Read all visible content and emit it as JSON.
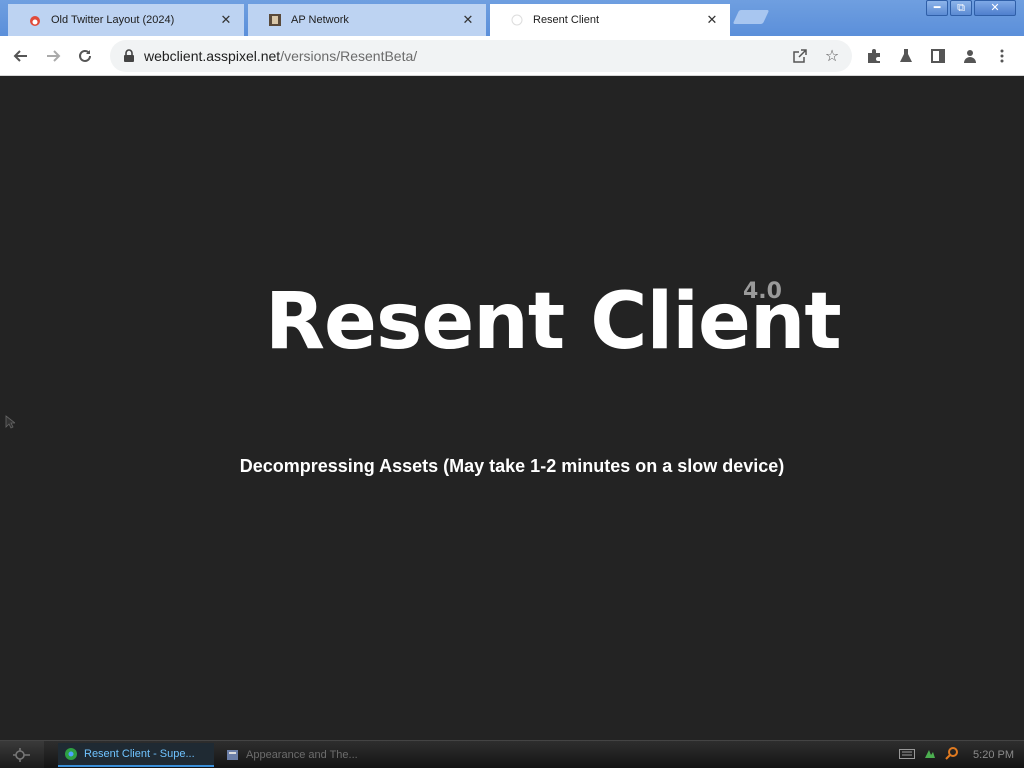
{
  "browser": {
    "tabs": [
      {
        "label": "Old Twitter Layout (2024)",
        "icon": "old-twitter-favicon",
        "active": false
      },
      {
        "label": "AP Network",
        "icon": "ap-network-favicon",
        "active": false
      },
      {
        "label": "Resent Client",
        "icon": "resent-client-favicon",
        "active": true
      }
    ],
    "tab_close_glyph": "✕",
    "url_host": "webclient.asspixel.net",
    "url_path": "/versions/ResentBeta/"
  },
  "page": {
    "logo_text": "Resent Client",
    "version": "4.0",
    "status": "Decompressing Assets (May take 1-2 minutes on a slow device)"
  },
  "taskbar": {
    "tasks": [
      {
        "label": "Resent Client - Supe...",
        "active": true
      },
      {
        "label": "Appearance and The...",
        "active": false
      }
    ],
    "clock": "5:20 PM"
  },
  "colors": {
    "page_bg": "#232323",
    "logo": "#ffffff",
    "version": "#9a9a9a",
    "titlebar": "#5b8fda"
  }
}
